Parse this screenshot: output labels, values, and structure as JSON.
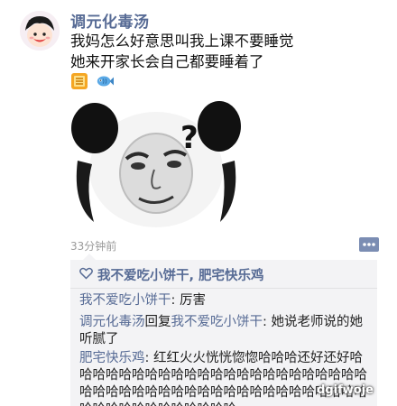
{
  "post": {
    "username": "调元化毒汤",
    "text_lines": [
      "我妈怎么好意思叫我上课不要睡觉",
      "她来开家长会自己都要睡着了"
    ],
    "emojis": [
      "fortune-slip-emoji",
      "fish-emoji"
    ],
    "image": "panda-face-meme-with-question-mark",
    "timestamp": "33分钟前"
  },
  "likes": {
    "icon": "heart-icon",
    "names": "我不爱吃小饼干, 肥宅快乐鸡"
  },
  "comments": [
    {
      "author": "我不爱吃小饼干",
      "separator": ": ",
      "text": "厉害"
    },
    {
      "author": "调元化毒汤",
      "reply_word": "回复",
      "reply_to": "我不爱吃小饼干",
      "separator": ": ",
      "text": "她说老师说的她听腻了"
    },
    {
      "author": "肥宅快乐鸡",
      "separator": ": ",
      "text": "红红火火恍恍惚惚哈哈哈还好还好哈哈哈哈哈哈哈哈哈哈哈哈哈哈哈哈哈哈哈哈哈哈哈哈哈哈哈哈哈哈哈哈哈哈哈哈哈哈哈哈哈哈哈哈哈哈哈哈哈哈哈哈哈哈哈哈哈"
    }
  ],
  "watermark": "dgifwoje",
  "colors": {
    "name_link": "#576b95",
    "comment_bg": "#f3f3f5",
    "timestamp": "#9a9a9a"
  }
}
